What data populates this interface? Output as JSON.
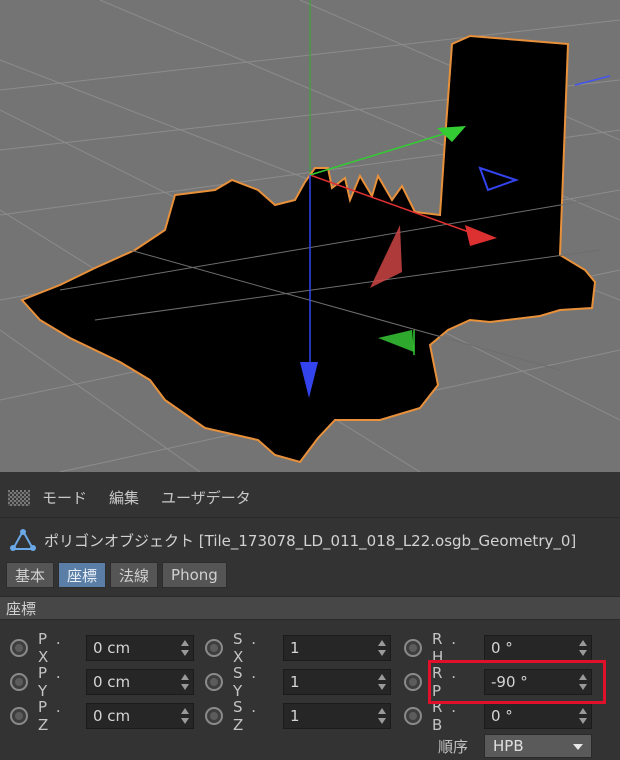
{
  "menubar": {
    "items": [
      "モード",
      "編集",
      "ユーザデータ"
    ]
  },
  "object": {
    "title": "ポリゴンオブジェクト [Tile_173078_LD_011_018_L22.osgb_Geometry_0]"
  },
  "tabs": [
    {
      "label": "基本",
      "active": false
    },
    {
      "label": "座標",
      "active": true
    },
    {
      "label": "法線",
      "active": false
    },
    {
      "label": "Phong",
      "active": false
    }
  ],
  "section": {
    "title": "座標"
  },
  "coords": {
    "px": {
      "label": "P . X",
      "value": "0 cm"
    },
    "py": {
      "label": "P . Y",
      "value": "0 cm"
    },
    "pz": {
      "label": "P . Z",
      "value": "0 cm"
    },
    "sx": {
      "label": "S . X",
      "value": "1"
    },
    "sy": {
      "label": "S . Y",
      "value": "1"
    },
    "sz": {
      "label": "S . Z",
      "value": "1"
    },
    "rh": {
      "label": "R . H",
      "value": "0 °"
    },
    "rp": {
      "label": "R . P",
      "value": "-90 °"
    },
    "rb": {
      "label": "R . B",
      "value": "0 °"
    }
  },
  "order": {
    "label": "順序",
    "value": "HPB"
  },
  "colors": {
    "viewport_bg": "#747474",
    "panel_bg": "#333333",
    "active_tab": "#5a7ea6",
    "highlight": "#e0102a",
    "axis_x": "#e03030",
    "axis_y": "#30c030",
    "axis_z": "#3040e0",
    "outline": "#e8903a"
  }
}
